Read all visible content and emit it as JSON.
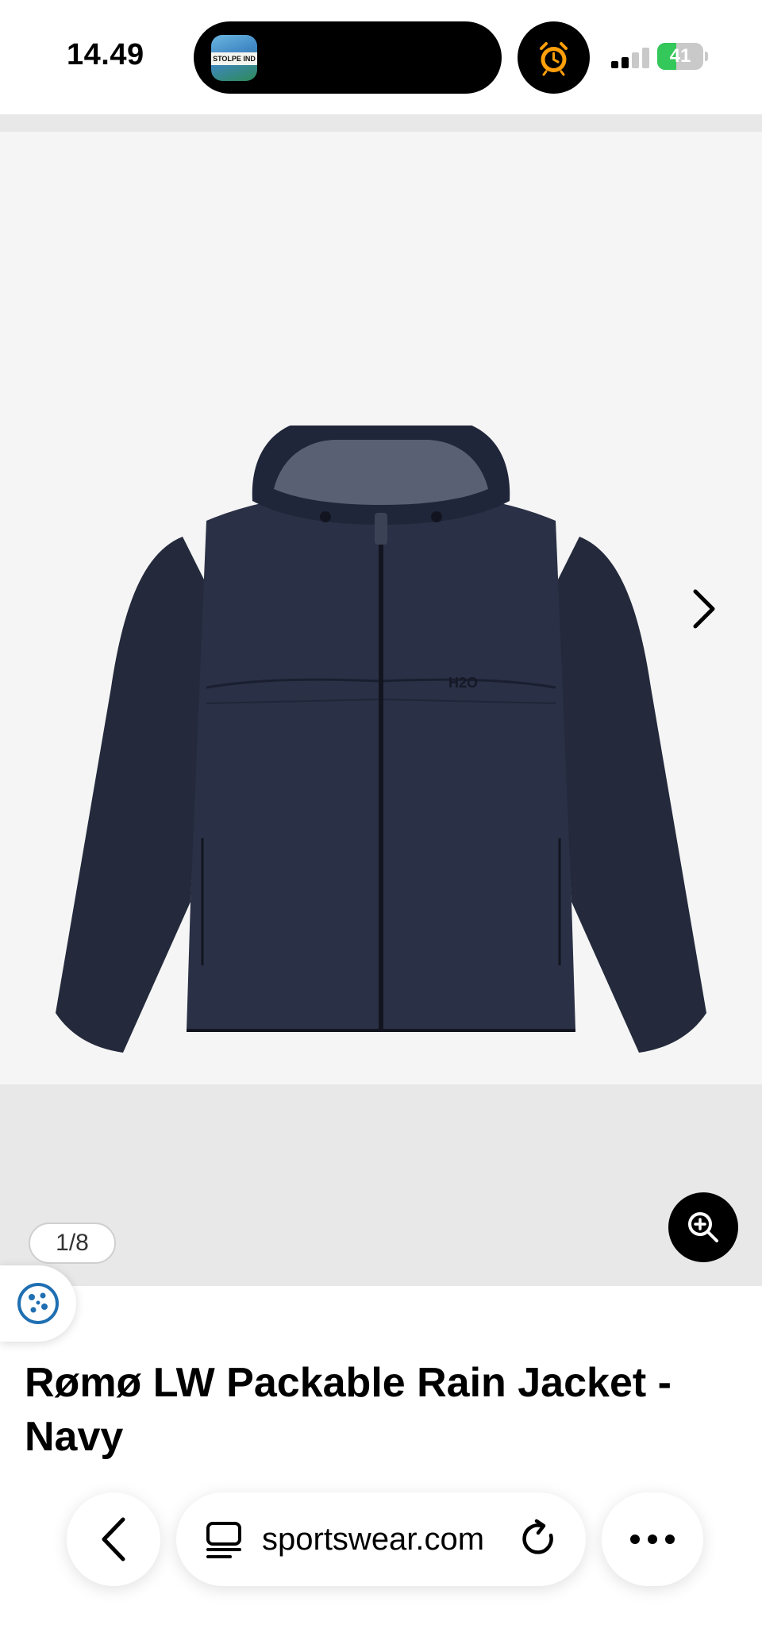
{
  "status_bar": {
    "time": "14.49",
    "island_app_label": "STOLPE IND",
    "battery_percent": "41",
    "battery_level": 0.41,
    "signal_bars_active": 2,
    "signal_bars_total": 4,
    "icons": [
      "alarm-clock-icon",
      "signal-icon",
      "battery-icon"
    ]
  },
  "gallery": {
    "counter": "1/8",
    "current_image": 1,
    "total_images": 8,
    "jacket_print": "H2O",
    "icons": [
      "chevron-right-icon",
      "zoom-in-icon",
      "cookie-icon"
    ],
    "colors": {
      "background": "#f5f5f5",
      "jacket": "#262b3f"
    }
  },
  "product": {
    "title": "Rømø LW Packable Rain Jacket - Navy"
  },
  "browser": {
    "url_text": "sportswear.com",
    "icons": [
      "back-chevron-icon",
      "tabs-icon",
      "reload-icon",
      "more-dots-icon"
    ]
  }
}
